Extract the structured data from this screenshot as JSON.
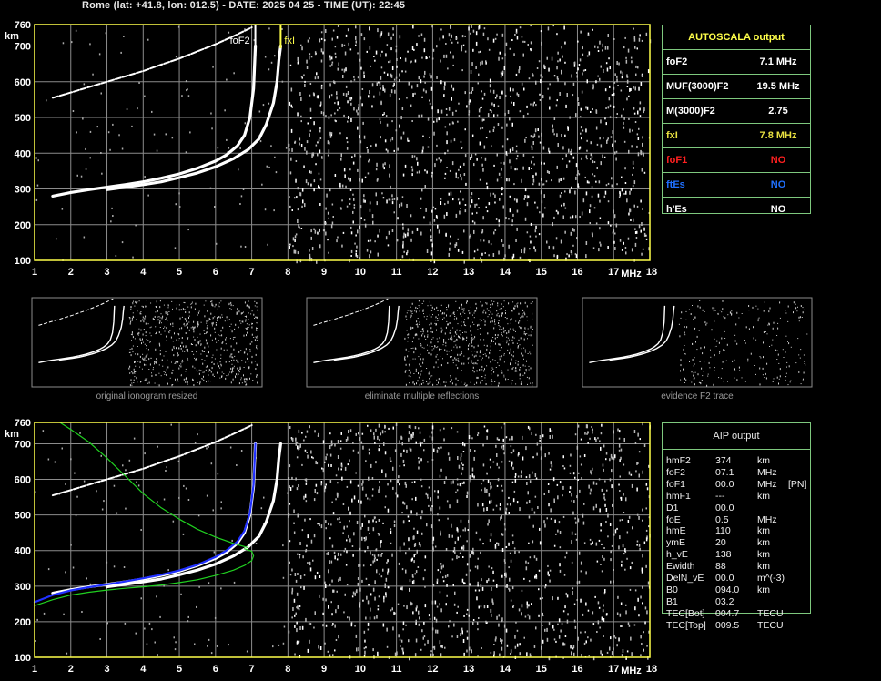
{
  "header": {
    "title": "Rome (lat: +41.8, lon: 012.5) - DATE: 2025 04 25 - TIME (UT): 22:45"
  },
  "colors": {
    "grid": "#8c8c8c",
    "frame": "#ffff4a",
    "box_border": "#7ec87e",
    "yellow": "#ffff4a",
    "red": "#ff2020",
    "blue": "#2070ff",
    "green": "#20d020",
    "profile_blue": "#2030ff",
    "trace": "#ffffff"
  },
  "autoscala": {
    "title": "AUTOSCALA output",
    "rows": [
      {
        "label": "foF2",
        "value": "7.1 MHz",
        "color": "#ffffff"
      },
      {
        "label": "MUF(3000)F2",
        "value": "19.5 MHz",
        "color": "#ffffff"
      },
      {
        "label": "M(3000)F2",
        "value": "2.75",
        "color": "#ffffff"
      },
      {
        "label": "fxI",
        "value": "7.8 MHz",
        "color": "#e8e040"
      },
      {
        "label": "foF1",
        "value": "NO",
        "color": "#ff2020"
      },
      {
        "label": "ftEs",
        "value": "NO",
        "color": "#2070ff"
      },
      {
        "label": "h'Es",
        "value": "NO",
        "color": "#ffffff"
      }
    ]
  },
  "aip": {
    "title": "AIP output",
    "rows": [
      {
        "name": "hmF2",
        "value": "374",
        "unit": "km"
      },
      {
        "name": "foF2",
        "value": "07.1",
        "unit": "MHz"
      },
      {
        "name": "foF1",
        "value": "00.0",
        "unit": "MHz",
        "extra": "[PN]"
      },
      {
        "name": "hmF1",
        "value": "---",
        "unit": "km"
      },
      {
        "name": "D1",
        "value": "00.0",
        "unit": ""
      },
      {
        "name": "foE",
        "value": "0.5",
        "unit": "MHz"
      },
      {
        "name": "hmE",
        "value": "110",
        "unit": "km"
      },
      {
        "name": "ymE",
        "value": "20",
        "unit": "km"
      },
      {
        "name": "h_vE",
        "value": "138",
        "unit": "km"
      },
      {
        "name": "Ewidth",
        "value": "88",
        "unit": "km"
      },
      {
        "name": "DelN_vE",
        "value": "00.0",
        "unit": "m^(-3)"
      },
      {
        "name": "B0",
        "value": "094.0",
        "unit": "km"
      },
      {
        "name": "B1",
        "value": "03.2",
        "unit": ""
      },
      {
        "name": "TEC[Bot]",
        "value": "004.7",
        "unit": "TECU"
      },
      {
        "name": "TEC[Top]",
        "value": "009.5",
        "unit": "TECU"
      }
    ]
  },
  "thumbnails": [
    {
      "caption": "original ionogram resized"
    },
    {
      "caption": "eliminate multiple reflections"
    },
    {
      "caption": "evidence F2 trace"
    }
  ],
  "chart_data": [
    {
      "type": "scatter",
      "name": "ionogram_autoscala",
      "xlabel": "MHz",
      "ylabel": "km",
      "xlim": [
        1,
        18
      ],
      "ylim": [
        100,
        760
      ],
      "xticks": [
        "1",
        "2",
        "3",
        "4",
        "5",
        "6",
        "7",
        "8",
        "9",
        "10",
        "11",
        "12",
        "13",
        "14",
        "15",
        "16",
        "17",
        "18"
      ],
      "yticks": [
        "100",
        "200",
        "300",
        "400",
        "500",
        "600",
        "700",
        "760"
      ],
      "grid": true,
      "markers": [
        {
          "label": "foF2",
          "x": 7.1,
          "color": "#ffffff"
        },
        {
          "label": "fxI",
          "x": 7.8,
          "color": "#ffff4a"
        }
      ],
      "traces": [
        {
          "name": "F2 ordinary",
          "color": "#ffffff",
          "x": [
            1.5,
            2.0,
            2.5,
            3.0,
            3.5,
            4.0,
            4.5,
            5.0,
            5.5,
            6.0,
            6.3,
            6.6,
            6.8,
            6.95,
            7.05,
            7.1
          ],
          "y": [
            280,
            290,
            298,
            305,
            312,
            320,
            330,
            342,
            358,
            378,
            395,
            420,
            450,
            500,
            580,
            700
          ]
        },
        {
          "name": "F2 extraordinary",
          "color": "#ffffff",
          "x": [
            3.0,
            3.5,
            4.0,
            4.5,
            5.0,
            5.5,
            6.0,
            6.5,
            6.9,
            7.2,
            7.4,
            7.6,
            7.7,
            7.75,
            7.8
          ],
          "y": [
            298,
            305,
            312,
            320,
            332,
            345,
            362,
            385,
            410,
            440,
            480,
            540,
            600,
            660,
            700
          ]
        },
        {
          "name": "second hop",
          "color": "#ffffff",
          "x": [
            1.5,
            2.0,
            2.5,
            3.0,
            3.5,
            4.0,
            4.5,
            5.0,
            5.5,
            6.0,
            6.5,
            7.0
          ],
          "y": [
            555,
            570,
            585,
            600,
            615,
            630,
            648,
            665,
            685,
            705,
            728,
            752
          ]
        }
      ]
    },
    {
      "type": "scatter",
      "name": "ionogram_aip",
      "xlabel": "MHz",
      "ylabel": "km",
      "xlim": [
        1,
        18
      ],
      "ylim": [
        100,
        760
      ],
      "xticks": [
        "1",
        "2",
        "3",
        "4",
        "5",
        "6",
        "7",
        "8",
        "9",
        "10",
        "11",
        "12",
        "13",
        "14",
        "15",
        "16",
        "17",
        "18"
      ],
      "yticks": [
        "100",
        "200",
        "300",
        "400",
        "500",
        "600",
        "700",
        "760"
      ],
      "grid": true,
      "traces": [
        {
          "name": "F2 ordinary",
          "color": "#ffffff",
          "x": [
            1.5,
            2.0,
            2.5,
            3.0,
            3.5,
            4.0,
            4.5,
            5.0,
            5.5,
            6.0,
            6.3,
            6.6,
            6.8,
            6.95,
            7.05,
            7.1
          ],
          "y": [
            280,
            290,
            298,
            305,
            312,
            320,
            330,
            342,
            358,
            378,
            395,
            420,
            450,
            500,
            580,
            700
          ]
        },
        {
          "name": "F2 extraordinary",
          "color": "#ffffff",
          "x": [
            3.0,
            3.5,
            4.0,
            4.5,
            5.0,
            5.5,
            6.0,
            6.5,
            6.9,
            7.2,
            7.4,
            7.6,
            7.7,
            7.75,
            7.8
          ],
          "y": [
            298,
            305,
            312,
            320,
            332,
            345,
            362,
            385,
            410,
            440,
            480,
            540,
            600,
            660,
            700
          ]
        },
        {
          "name": "second hop",
          "color": "#ffffff",
          "x": [
            1.5,
            2.0,
            2.5,
            3.0,
            3.5,
            4.0,
            4.5,
            5.0,
            5.5,
            6.0,
            6.5,
            7.0
          ],
          "y": [
            555,
            570,
            585,
            600,
            615,
            630,
            648,
            665,
            685,
            705,
            728,
            752
          ]
        },
        {
          "name": "computed trace",
          "color": "#2030ff",
          "x": [
            1.0,
            1.5,
            2.0,
            2.5,
            3.0,
            3.5,
            4.0,
            4.5,
            5.0,
            5.5,
            6.0,
            6.3,
            6.6,
            6.8,
            6.95,
            7.05,
            7.1
          ],
          "y": [
            255,
            275,
            288,
            297,
            305,
            313,
            322,
            332,
            344,
            360,
            382,
            400,
            425,
            455,
            505,
            585,
            700
          ]
        },
        {
          "name": "profile lower",
          "color": "#20d020",
          "x": [
            1.0,
            1.5,
            2.0,
            2.5,
            3.0,
            3.5,
            4.0,
            4.5,
            5.0,
            5.5,
            6.0,
            6.5,
            6.8,
            7.0,
            7.05,
            7.0,
            6.8
          ],
          "y": [
            245,
            262,
            275,
            283,
            289,
            294,
            298,
            303,
            310,
            318,
            330,
            345,
            358,
            372,
            385,
            398,
            405
          ]
        },
        {
          "name": "profile upper",
          "color": "#20d020",
          "x": [
            6.9,
            6.5,
            6.0,
            5.5,
            5.0,
            4.5,
            4.0,
            3.5,
            3.0,
            2.5,
            2.0,
            1.7
          ],
          "y": [
            408,
            420,
            438,
            460,
            488,
            520,
            560,
            610,
            660,
            705,
            740,
            760
          ]
        }
      ]
    }
  ]
}
